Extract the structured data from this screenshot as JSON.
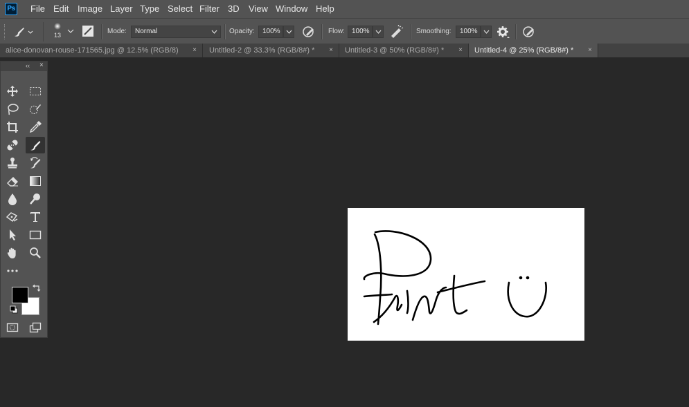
{
  "app": {
    "logo_text": "Ps"
  },
  "menu": [
    "File",
    "Edit",
    "Image",
    "Layer",
    "Type",
    "Select",
    "Filter",
    "3D",
    "View",
    "Window",
    "Help"
  ],
  "options": {
    "brush_size": "13",
    "mode_label": "Mode:",
    "mode_value": "Normal",
    "opacity_label": "Opacity:",
    "opacity_value": "100%",
    "flow_label": "Flow:",
    "flow_value": "100%",
    "smoothing_label": "Smoothing:",
    "smoothing_value": "100%"
  },
  "tabs": [
    {
      "label": "alice-donovan-rouse-171565.jpg @ 12.5% (RGB/8)",
      "active": false
    },
    {
      "label": "Untitled-2 @ 33.3% (RGB/8#) *",
      "active": false
    },
    {
      "label": "Untitled-3 @ 50% (RGB/8#) *",
      "active": false
    },
    {
      "label": "Untitled-4 @ 25% (RGB/8#) *",
      "active": true
    }
  ],
  "tab_close_glyph": "×",
  "toolbar": {
    "collapse_glyph": "‹‹",
    "close_glyph": "×",
    "active_tool": "brush-tool"
  },
  "colors": {
    "foreground": "#000000",
    "background": "#ffffff",
    "chrome": "#535353",
    "workspace": "#282828"
  },
  "canvas": {
    "content": "hand-drawn-word-and-smiley"
  }
}
